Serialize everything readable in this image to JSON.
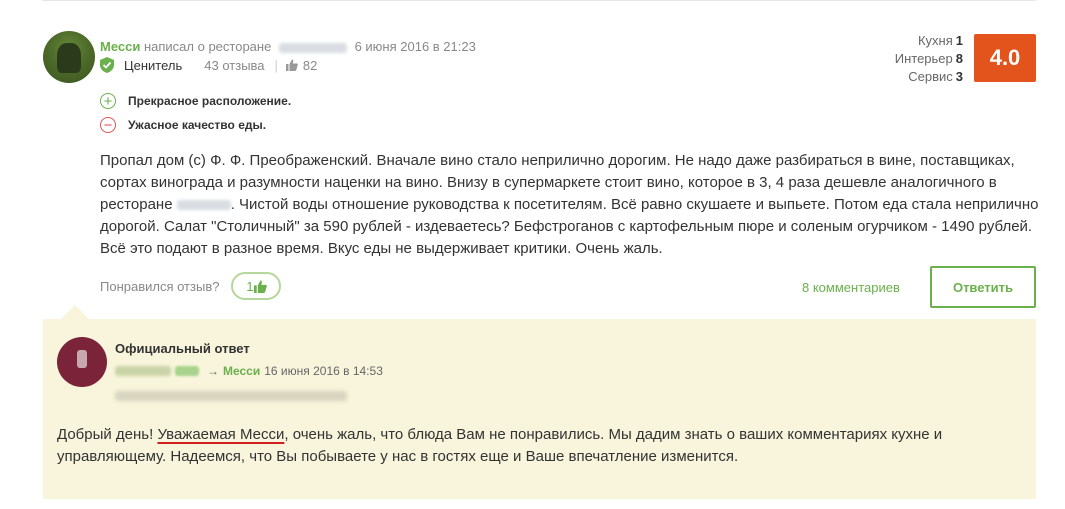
{
  "review": {
    "author": "Месси",
    "wrote_about": "написал о ресторане",
    "date": "6 июня 2016 в 21:23",
    "level": "Ценитель",
    "reviews_count": "43 отзыва",
    "likes_count": "82",
    "ratings": [
      {
        "label": "Кухня",
        "value": "1"
      },
      {
        "label": "Интерьер",
        "value": "8"
      },
      {
        "label": "Сервис",
        "value": "3"
      }
    ],
    "score": "4.0",
    "pro": "Прекрасное расположение.",
    "con": "Ужасное качество еды.",
    "text_1": "Пропал дом (с) Ф. Ф. Преображенский. Вначале вино стало неприлично дорогим. Не надо даже разбираться в вине, поставщиках, сортах винограда и разумности наценки на вино. Внизу в супермаркете стоит вино, которое в 3, 4 раза дешевле аналогичного в ресторане ",
    "text_2": ". Чистой воды отношение руководства к посетителям. Всё равно скушаете и выпьете. Потом еда стала неприлично дорогой. Салат \"Столичный\" за 590 рублей - издеваетесь? Бефстроганов с картофельным пюре и соленым огурчиком - 1490 рублей. Всё это подают в разное время. Вкус еды не выдерживает критики. Очень жаль.",
    "liked_label": "Понравился отзыв?",
    "like_count": "1",
    "comments_link": "8 комментариев",
    "reply_button": "Ответить"
  },
  "official_reply": {
    "title": "Официальный ответ",
    "arrow": "→",
    "to_author": "Месси",
    "date": "16 июня 2016 в 14:53",
    "greeting": "Добрый день! ",
    "addressee": "Уважаемая Месси",
    "text": ", очень жаль, что блюда Вам не понравились. Мы дадим знать о ваших комментариях кухне и управляющему. Надеемся, что Вы побываете у нас в гостях еще и Ваше впечатление изменится."
  },
  "colors": {
    "accent_green": "#6ab04c",
    "score_bg": "#e2541b",
    "con_red": "#e25353",
    "reply_bg": "#f8f5dc",
    "underline_red": "#d11f1f"
  }
}
